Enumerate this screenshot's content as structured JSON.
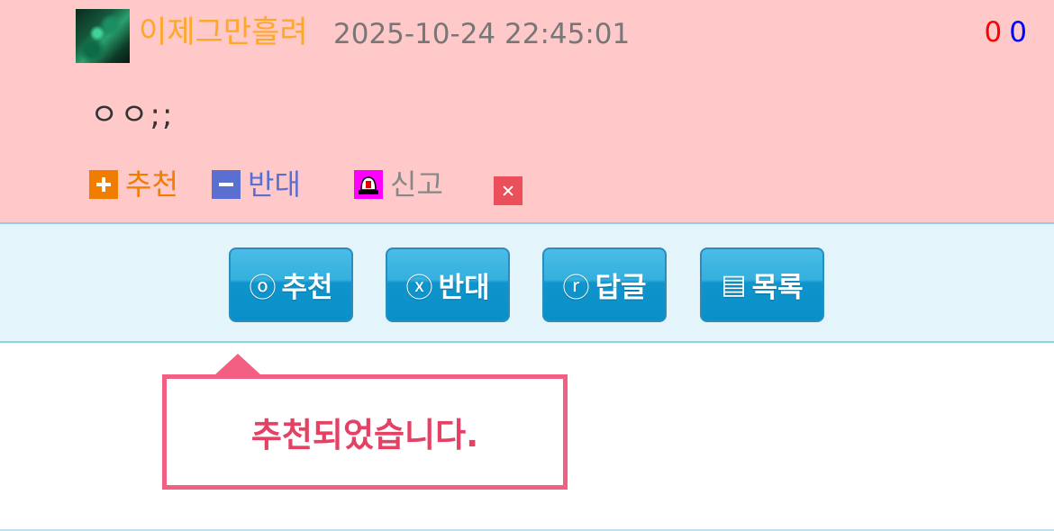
{
  "comment": {
    "author": "이제그만흘려",
    "timestamp": "2025-10-24 22:45:01",
    "upvotes": "0",
    "downvotes": "0",
    "text": "ㅇㅇ;;",
    "actions": {
      "recommend": "추천",
      "oppose": "반대",
      "report": "신고"
    }
  },
  "toolbar": {
    "recommend": {
      "icon": "ⓞ",
      "label": "추천"
    },
    "oppose": {
      "icon": "ⓧ",
      "label": "반대"
    },
    "reply": {
      "icon": "ⓡ",
      "label": "답글"
    },
    "list": {
      "icon": "▤",
      "label": "목록"
    }
  },
  "tooltip": {
    "message": "추천되었습니다."
  },
  "colors": {
    "comment_bg": "#ffc9c9",
    "author": "#ffa726",
    "button": "#0f95cc",
    "tooltip_border": "#f35f82",
    "tooltip_text": "#e44165"
  }
}
